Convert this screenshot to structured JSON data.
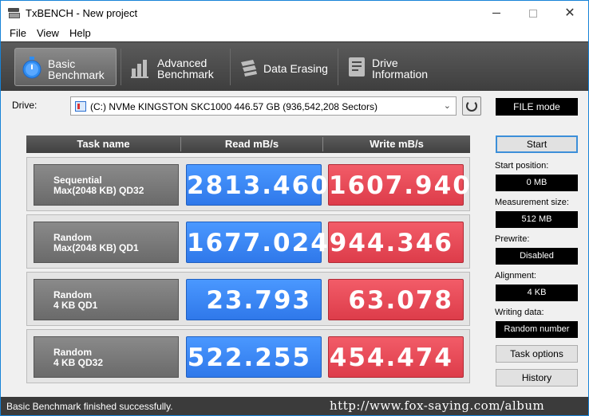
{
  "window": {
    "title": "TxBENCH - New project",
    "close_glyph": "✕"
  },
  "menu": [
    "File",
    "View",
    "Help"
  ],
  "toolbar": [
    {
      "line1": "Basic",
      "line2": "Benchmark",
      "icon": "stopwatch-icon",
      "active": true
    },
    {
      "line1": "Advanced",
      "line2": "Benchmark",
      "icon": "bar-chart-icon",
      "active": false
    },
    {
      "line1": "Data Erasing",
      "line2": "",
      "icon": "eraser-icon",
      "active": false
    },
    {
      "line1": "Drive",
      "line2": "Information",
      "icon": "drive-info-icon",
      "active": false
    }
  ],
  "drive": {
    "label": "Drive:",
    "selected": "(C:) NVMe KINGSTON SKC1000  446.57 GB (936,542,208 Sectors)"
  },
  "mode": "FILE mode",
  "start_label": "Start",
  "settings": {
    "start_position": {
      "label": "Start position:",
      "value": "0 MB"
    },
    "measurement_size": {
      "label": "Measurement size:",
      "value": "512 MB"
    },
    "prewrite": {
      "label": "Prewrite:",
      "value": "Disabled"
    },
    "alignment": {
      "label": "Alignment:",
      "value": "4 KB"
    },
    "writing_data": {
      "label": "Writing data:",
      "value": "Random number"
    }
  },
  "buttons": {
    "task_options": "Task options",
    "history": "History"
  },
  "table": {
    "headers": [
      "Task name",
      "Read mB/s",
      "Write mB/s"
    ],
    "rows": [
      {
        "name1": "Sequential",
        "name2": "Max(2048 KB) QD32",
        "read": "2813.460",
        "write": "1607.940"
      },
      {
        "name1": "Random",
        "name2": "Max(2048 KB) QD1",
        "read": "1677.024",
        "write": "944.346"
      },
      {
        "name1": "Random",
        "name2": "4 KB QD1",
        "read": "23.793",
        "write": "63.078"
      },
      {
        "name1": "Random",
        "name2": "4 KB QD32",
        "read": "522.255",
        "write": "454.474"
      }
    ]
  },
  "status": "Basic Benchmark finished successfully.",
  "watermark": "http://www.fox-saying.com/album",
  "colors": {
    "read": "#3c8af5",
    "write": "#e84b58",
    "accent": "#1883d7"
  }
}
